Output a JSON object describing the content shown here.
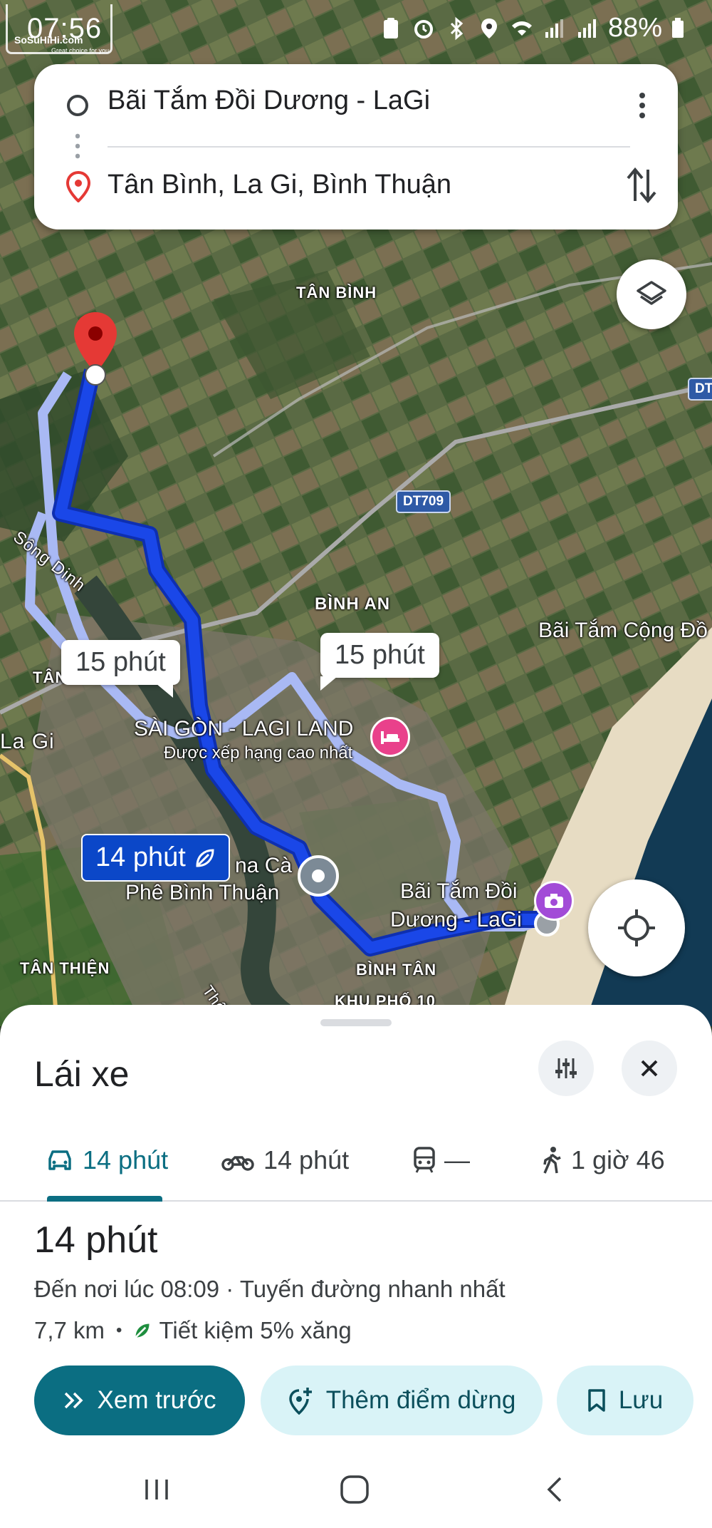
{
  "status_bar": {
    "time": "07:56",
    "battery": "88%",
    "watermark": "SoSuHiHi.com",
    "watermark_sub": "Great choice for you"
  },
  "route_card": {
    "origin": "Bãi Tắm Đồi Dương - LaGi",
    "destination": "Tân Bình, La Gi, Bình Thuận"
  },
  "map": {
    "labels": {
      "tan_binh": "TÂN BÌNH",
      "binh_an": "BÌNH AN",
      "binh_tan": "BÌNH TÂN",
      "tan_thien": "TÂN THIỆN",
      "tan_partial": "TÂN",
      "la_gi": "La Gi",
      "song_dinh": "Sông Dinh",
      "khu_pho_partial": "KHU PHỐ 10",
      "road_partial": "Thố"
    },
    "road_badges": {
      "dt709": "DT709",
      "dt_edge": "DT"
    },
    "pois": {
      "lagi_land": "SÀI GÒN - LAGI LAND",
      "lagi_land_sub": "Được xếp hạng cao nhất",
      "beach_cong_dong": "Bãi Tắm Cộng Đồ",
      "cafe_line1": "na Cà",
      "cafe_line2": "Phê Bình Thuận",
      "beach_line1": "Bãi Tắm Đồi",
      "beach_line2": "Dương - LaGi"
    },
    "callouts": {
      "alt_left": "15 phút",
      "alt_right": "15 phút",
      "selected": "14 phút"
    },
    "colors": {
      "route_main": "#1a47e8",
      "route_alt": "#a9b9f4",
      "dest_pin": "#e53935",
      "hotel_pin": "#e9418b",
      "camera_pin": "#a24bd7"
    }
  },
  "sheet": {
    "title": "Lái xe",
    "tabs": [
      {
        "icon": "car-icon",
        "label": "14 phút"
      },
      {
        "icon": "motorbike-icon",
        "label": "14 phút"
      },
      {
        "icon": "transit-icon",
        "label": "—"
      },
      {
        "icon": "walk-icon",
        "label": "1 giờ 46"
      }
    ],
    "duration": "14 phút",
    "arrival": "Đến nơi lúc 08:09 · Tuyến đường nhanh nhất",
    "distance": "7,7 km",
    "separator": "•",
    "eco": "Tiết kiệm 5% xăng",
    "buttons": {
      "preview": "Xem trước",
      "add_stop": "Thêm điểm dừng",
      "save": "Lưu"
    },
    "accent": "#0b6e82"
  }
}
